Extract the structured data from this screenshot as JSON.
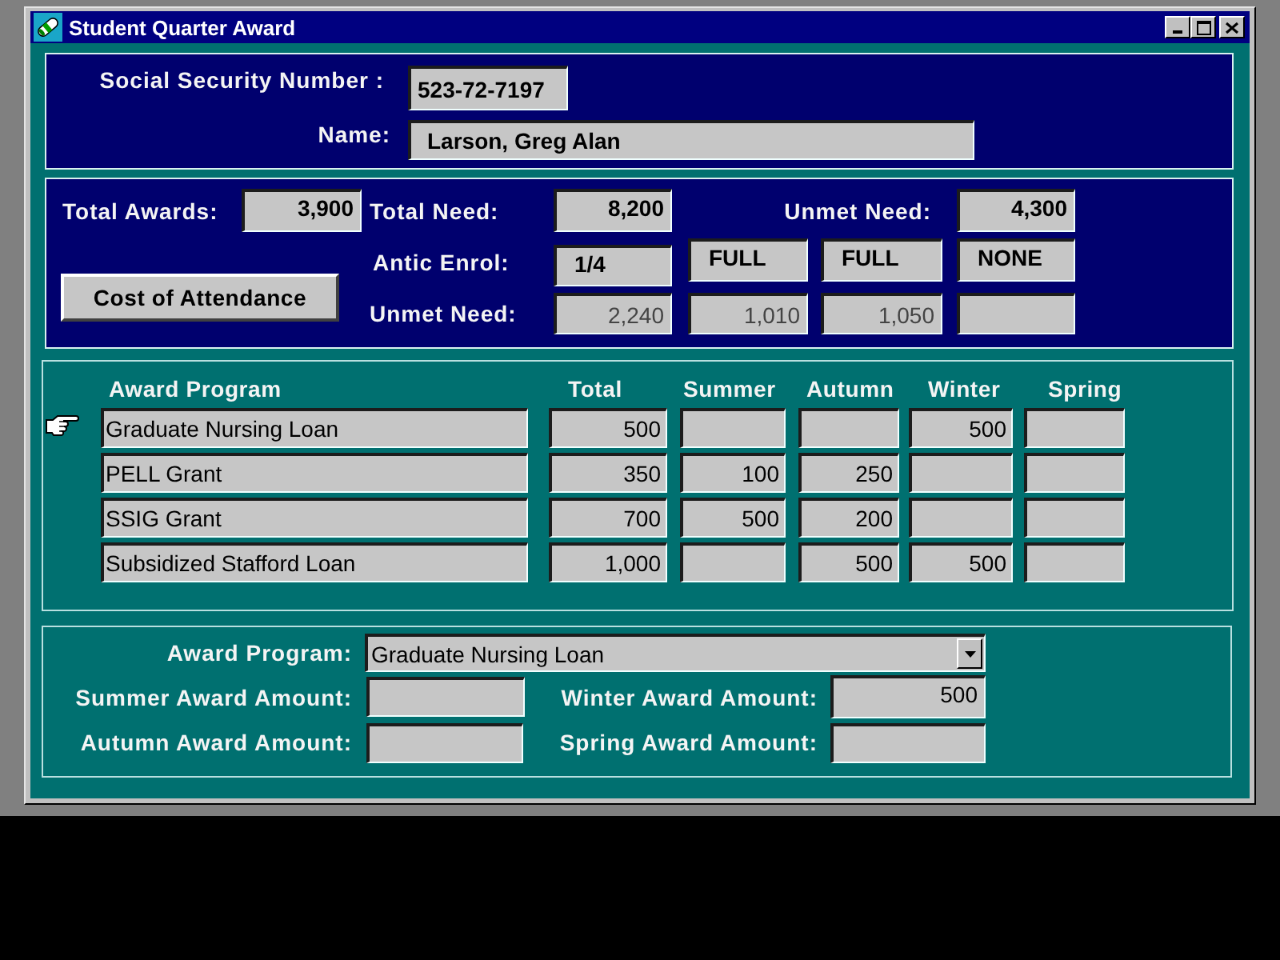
{
  "window": {
    "title": "Student Quarter Award"
  },
  "student": {
    "ssn_label": "Social Security Number :",
    "ssn": "523-72-7197",
    "name_label": "Name:",
    "name": "Larson, Greg Alan"
  },
  "summary": {
    "total_awards_label": "Total Awards:",
    "total_awards": "3,900",
    "total_need_label": "Total Need:",
    "total_need": "8,200",
    "unmet_need_label": "Unmet Need:",
    "unmet_need": "4,300",
    "cost_button": "Cost of Attendance",
    "antic_enrol_label": "Antic Enrol:",
    "antic_enrol": [
      "1/4",
      "FULL",
      "FULL",
      "NONE"
    ],
    "quarter_unmet_label": "Unmet Need:",
    "quarter_unmet": [
      "2,240",
      "1,010",
      "1,050"
    ]
  },
  "awards_table": {
    "columns": [
      "Award Program",
      "Total",
      "Summer",
      "Autumn",
      "Winter",
      "Spring"
    ],
    "rows": [
      {
        "selected": true,
        "program": "Graduate Nursing Loan",
        "total": "500",
        "winter": "500"
      },
      {
        "selected": false,
        "program": "PELL Grant",
        "total": "350",
        "summer": "100",
        "autumn": "250"
      },
      {
        "selected": false,
        "program": "SSIG Grant",
        "total": "700",
        "summer": "500",
        "autumn": "200"
      },
      {
        "selected": false,
        "program": "Subsidized Stafford Loan",
        "total": "1,000",
        "autumn": "500",
        "winter": "500"
      }
    ]
  },
  "award_detail": {
    "program_label": "Award Program:",
    "program": "Graduate Nursing Loan",
    "amounts": [
      {
        "label": "Summer Award Amount:"
      },
      {
        "label": "Winter Award Amount:",
        "value": "500"
      },
      {
        "label": "Autumn Award Amount:"
      },
      {
        "label": "Spring Award Amount:"
      }
    ]
  }
}
